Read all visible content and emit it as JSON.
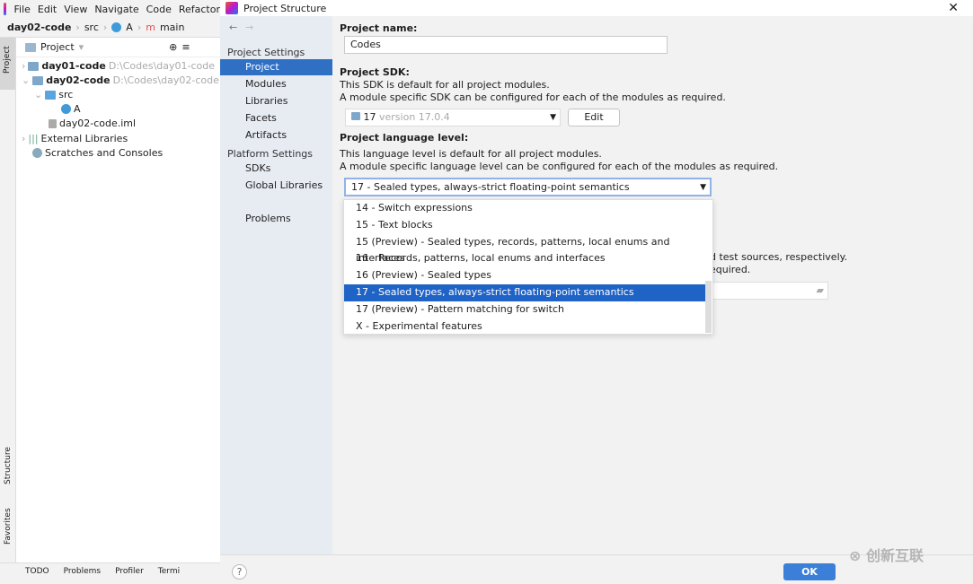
{
  "ide": {
    "menu": [
      "File",
      "Edit",
      "View",
      "Navigate",
      "Code",
      "Refactor"
    ],
    "breadcrumb": [
      "day02-code",
      "src",
      "A",
      "main"
    ],
    "panel_title": "Project",
    "tree": [
      {
        "name": "day01-code",
        "path": "D:\\Codes\\day01-code"
      },
      {
        "name": "day02-code",
        "path": "D:\\Codes\\day02-code"
      },
      {
        "name": "src"
      },
      {
        "name": "A"
      },
      {
        "name": "day02-code.iml"
      },
      {
        "name": "External Libraries"
      },
      {
        "name": "Scratches and Consoles"
      }
    ],
    "side_tabs": [
      "Project",
      "Structure",
      "Favorites"
    ],
    "bottom_tabs": [
      "TODO",
      "Problems",
      "Profiler",
      "Termi"
    ]
  },
  "dialog": {
    "title": "Project Structure",
    "sidebar": {
      "project_settings": "Project Settings",
      "items1": [
        "Project",
        "Modules",
        "Libraries",
        "Facets",
        "Artifacts"
      ],
      "platform_settings": "Platform Settings",
      "items2": [
        "SDKs",
        "Global Libraries"
      ],
      "problems": "Problems"
    },
    "project_name_label": "Project name:",
    "project_name": "Codes",
    "sdk_label": "Project SDK:",
    "sdk_desc1": "This SDK is default for all project modules.",
    "sdk_desc2": "A module specific SDK can be configured for each of the modules as required.",
    "sdk_value": "17",
    "sdk_version": "version 17.0.4",
    "edit": "Edit",
    "lang_label": "Project language level:",
    "lang_desc1": "This language level is default for all project modules.",
    "lang_desc2": "A module specific language level can be configured for each of the modules as required.",
    "lang_value": "17 - Sealed types, always-strict floating-point semantics",
    "options": [
      "14 - Switch expressions",
      "15 - Text blocks",
      "15 (Preview) - Sealed types, records, patterns, local enums and interfaces",
      "16 - Records, patterns, local enums and interfaces",
      "16 (Preview) - Sealed types",
      "17 - Sealed types, always-strict floating-point semantics",
      "17 (Preview) - Pattern matching for switch",
      "X - Experimental features"
    ],
    "behind1": "d test sources, respectively.",
    "behind2": "equired.",
    "ok": "OK",
    "help": "?"
  },
  "watermark": "创新互联"
}
